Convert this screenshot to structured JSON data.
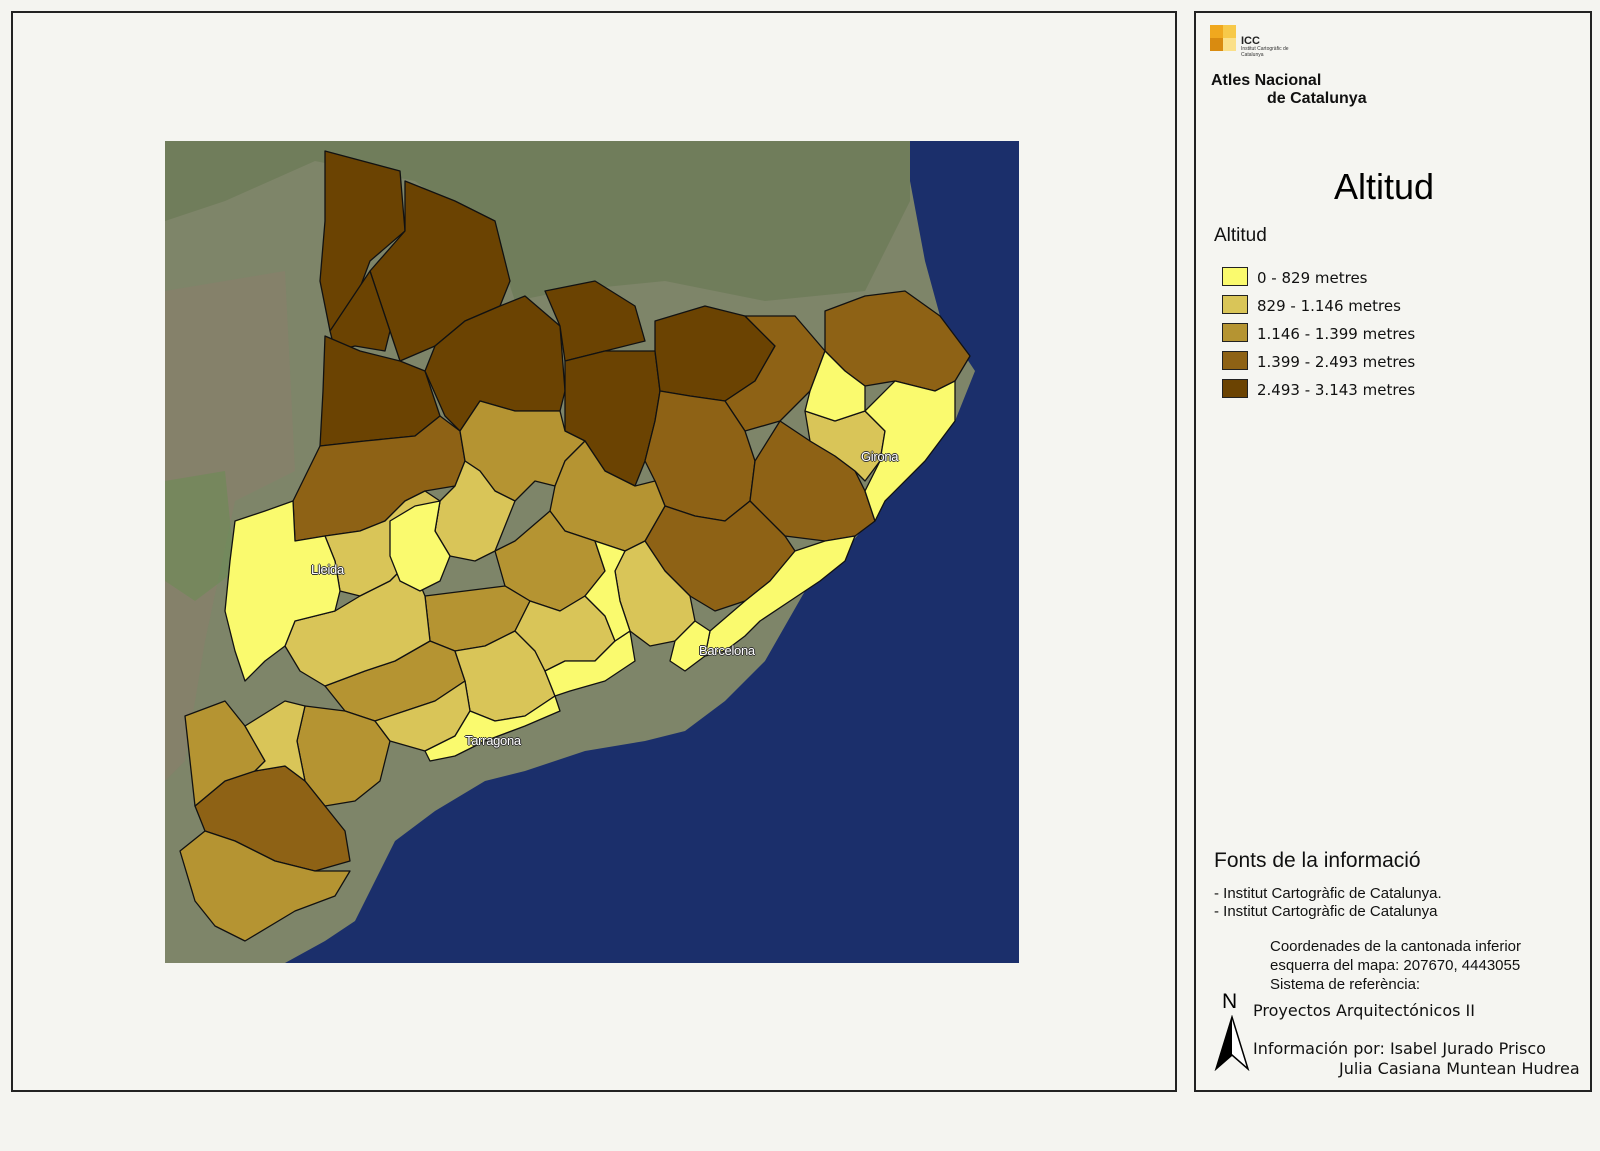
{
  "map": {
    "cities": {
      "lleida": "Lleida",
      "girona": "Girona",
      "barcelona": "Barcelona",
      "tarragona": "Tarragona"
    },
    "colors": {
      "sea": "#1b2f6b",
      "land": "#7e8569",
      "mountain": "#6d7b57",
      "border": "#111111"
    }
  },
  "logo": {
    "icc": "ICC",
    "institute": "Institut Cartogràfic de Catalunya",
    "title_line1": "Atles Nacional",
    "title_line2": "de Catalunya",
    "colors": [
      "#f0a81e",
      "#f7c94a",
      "#d98b10",
      "#fbe08a"
    ]
  },
  "legend": {
    "title": "Altitud",
    "subtitle": "Altitud",
    "classes": [
      {
        "label": "0 - 829 metres",
        "color": "#fafa6e"
      },
      {
        "label": "829 - 1.146 metres",
        "color": "#d9c558"
      },
      {
        "label": "1.146 - 1.399 metres",
        "color": "#b59432"
      },
      {
        "label": "1.399 - 2.493 metres",
        "color": "#8e6215"
      },
      {
        "label": "2.493 - 3.143 metres",
        "color": "#6b4302"
      }
    ]
  },
  "sources": {
    "title": "Fonts de la informació",
    "lines": [
      "- Institut Cartogràfic de Catalunya.",
      "- Institut Cartogràfic de Catalunya"
    ]
  },
  "coordinates": {
    "line1": "Coordenades de la cantonada inferior",
    "line2": "esquerra del mapa: 207670, 4443055",
    "line3": "Sistema de referència:"
  },
  "north": "N",
  "project": "Proyectos Arquitectónicos II",
  "credits": {
    "line1": "Información por: Isabel Jurado Prisco",
    "line2": "Julia Casiana Muntean Hudrea"
  }
}
